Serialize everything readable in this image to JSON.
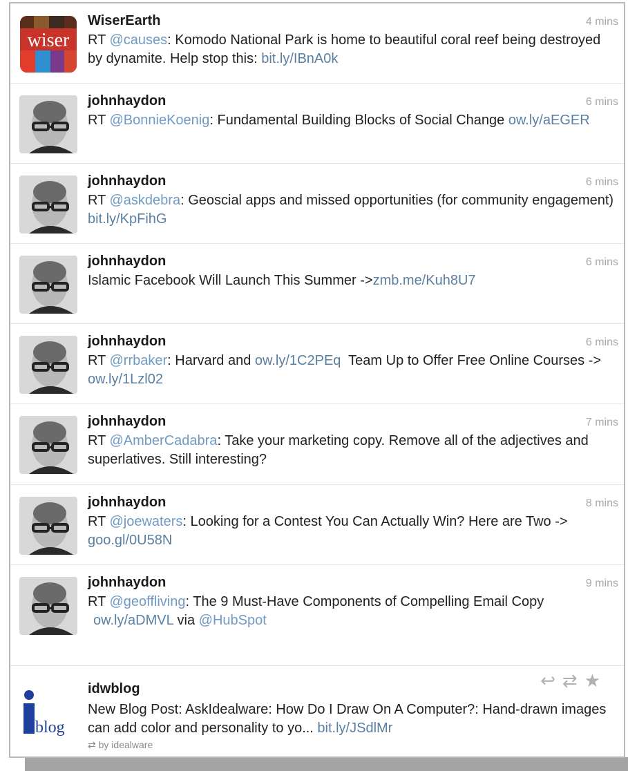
{
  "tweets": [
    {
      "author": "WiserEarth",
      "time": "4 mins",
      "avatar": "wiser-logo",
      "pre": "RT ",
      "mention": "@causes",
      "body": ": Komodo National Park is home to beautiful coral reef being destroyed by dynamite. Help stop this: ",
      "link": "bit.ly/IBnA0k"
    },
    {
      "author": "johnhaydon",
      "time": "6 mins",
      "avatar": "john-photo",
      "pre": "RT ",
      "mention": "@BonnieKoenig",
      "body": ": Fundamental Building Blocks of Social Change ",
      "link": "ow.ly/aEGER"
    },
    {
      "author": "johnhaydon",
      "time": "6 mins",
      "avatar": "john-photo",
      "pre": "RT ",
      "mention": "@askdebra",
      "body": ": Geoscial apps and missed opportunities (for community engagement) ",
      "link": "bit.ly/KpFihG"
    },
    {
      "author": "johnhaydon",
      "time": "6 mins",
      "avatar": "john-photo",
      "body": "Islamic Facebook Will Launch This Summer ->",
      "link": "zmb.me/Kuh8U7"
    },
    {
      "author": "johnhaydon",
      "time": "6 mins",
      "avatar": "john-photo",
      "pre": "RT ",
      "mention": "@rrbaker",
      "body": ": Harvard and ",
      "link": "ow.ly/1C2PEq",
      "body2": "  Team Up to Offer Free Online Courses -> ",
      "link2": "ow.ly/1Lzl02"
    },
    {
      "author": "johnhaydon",
      "time": "7 mins",
      "avatar": "john-photo",
      "pre": "RT ",
      "mention": "@AmberCadabra",
      "body": ": Take your marketing copy. Remove all of the adjectives and superlatives. Still interesting?"
    },
    {
      "author": "johnhaydon",
      "time": "8 mins",
      "avatar": "john-photo",
      "pre": "RT ",
      "mention": "@joewaters",
      "body": ": Looking for a Contest You Can Actually Win? Here are Two -> ",
      "link": "goo.gl/0U58N"
    },
    {
      "author": "johnhaydon",
      "time": "9 mins",
      "avatar": "john-photo",
      "pre": "RT ",
      "mention": "@geoffliving",
      "body": ": The 9 Must-Have Components of Compelling Email Copy",
      "link": "ow.ly/aDMVL",
      "body2": " via ",
      "mention2": "@HubSpot"
    },
    {
      "author": "idwblog",
      "avatar": "iblog-logo",
      "body": "New Blog Post: AskIdealware: How Do I Draw On A Computer?: Hand-drawn images can add color and personality to yo... ",
      "link": "bit.ly/JSdlMr",
      "retweet_note": "by idealware",
      "actions": [
        "reply-icon",
        "retweet-icon",
        "favorite-icon"
      ]
    }
  ],
  "colors": {
    "link": "#5a7fa0",
    "mention": "#6f9ac2",
    "time": "#a8a8a8"
  }
}
